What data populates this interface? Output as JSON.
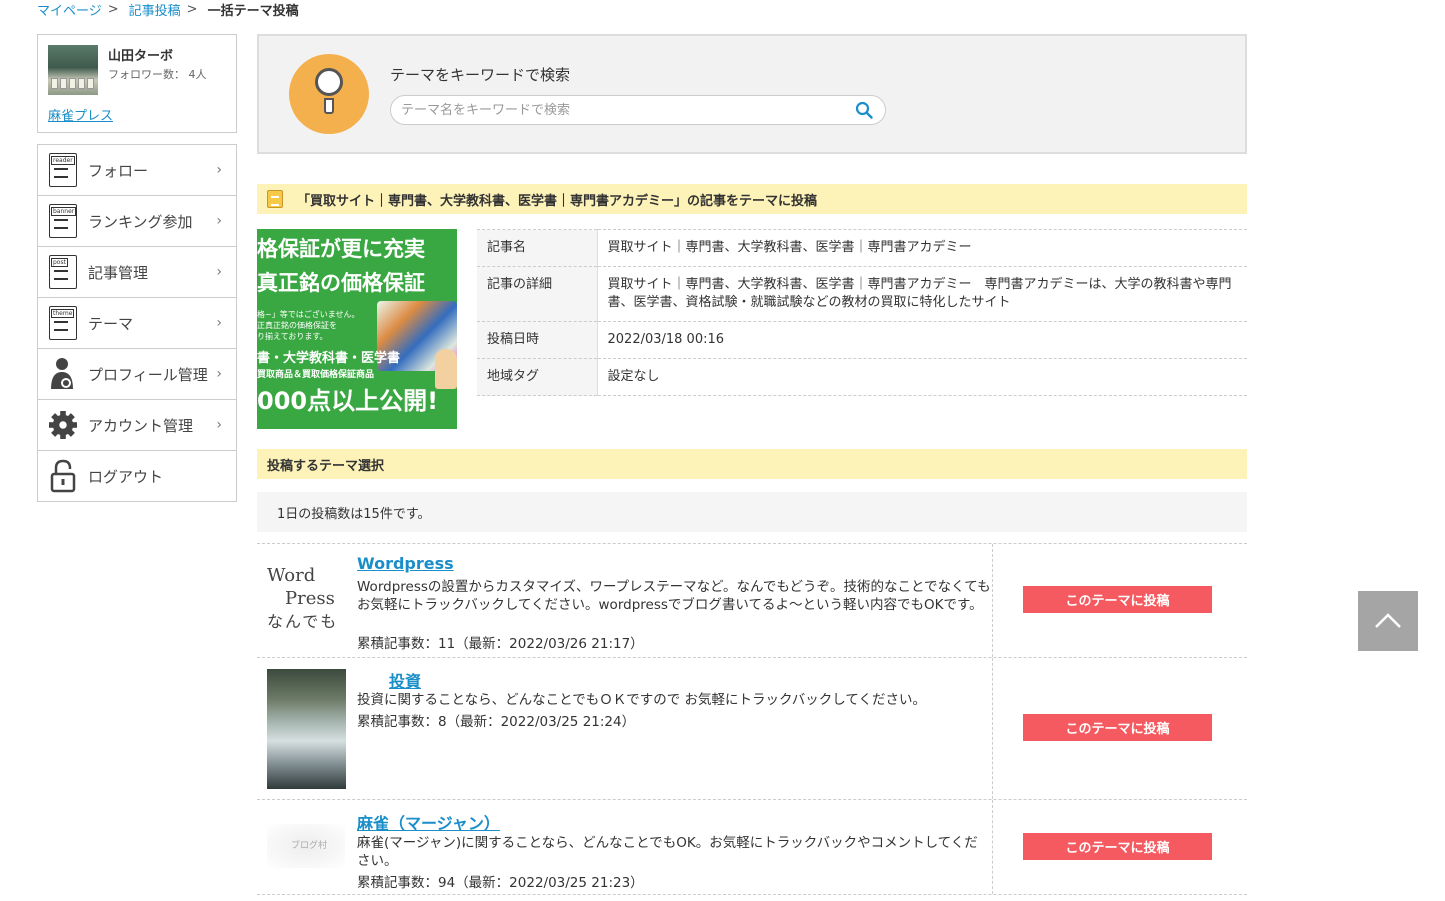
{
  "breadcrumb": {
    "items": [
      "マイページ",
      "記事投稿"
    ],
    "separator": ">",
    "current": "一括テーマ投稿"
  },
  "profile": {
    "name": "山田ターボ",
    "followers": "フォロワー数： 4人",
    "blog_name": "麻雀プレス"
  },
  "sidebar": {
    "items": [
      {
        "label": "フォロー",
        "icon": "reader-icon",
        "icon_tag": "reader"
      },
      {
        "label": "ランキング参加",
        "icon": "banner-icon",
        "icon_tag": "banner"
      },
      {
        "label": "記事管理",
        "icon": "post-icon",
        "icon_tag": "post"
      },
      {
        "label": "テーマ",
        "icon": "theme-icon",
        "icon_tag": "theme"
      },
      {
        "label": "プロフィール管理",
        "icon": "profile-icon"
      },
      {
        "label": "アカウント管理",
        "icon": "gear-icon"
      },
      {
        "label": "ログアウト",
        "icon": "lock-icon"
      }
    ],
    "chevron": "›"
  },
  "search": {
    "title": "テーマをキーワードで検索",
    "placeholder": "テーマ名をキーワードで検索",
    "value": ""
  },
  "post_section": {
    "heading": "「買取サイト｜専門書、大学教科書、医学書｜専門書アカデミー」の記事をテーマに投稿",
    "image": {
      "lines": [
        "格保証が更に充実",
        "真正銘の価格保証",
        "格~」等ではございません。\n正真正銘の価格保証を\nり揃えております。",
        "書・大学教科書・医学書",
        "買取商品＆買取価格保証商品",
        "000点以上公開!"
      ]
    },
    "details": [
      {
        "key": "記事名",
        "value": "買取サイト｜専門書、大学教科書、医学書｜専門書アカデミー"
      },
      {
        "key": "記事の詳細",
        "value": "買取サイト｜専門書、大学教科書、医学書｜専門書アカデミー　専門書アカデミーは、大学の教科書や専門書、医学書、資格試験・就職試験などの教材の買取に特化したサイト"
      },
      {
        "key": "投稿日時",
        "value": "2022/03/18 00:16"
      },
      {
        "key": "地域タグ",
        "value": "設定なし"
      }
    ]
  },
  "theme_section": {
    "heading": "投稿するテーマ選択",
    "daily_limit": "1日の投稿数は15件です。",
    "button_label": "このテーマに投稿",
    "themes": [
      {
        "title": "Wordpress",
        "description": "Wordpressの設置からカスタマイズ、ワープレステーマなど。なんでもどうぞ。技術的なことでなくてもお気軽にトラックバックしてください。wordpressでブログ書いてるよ～という軽い内容でもOKです。",
        "count": "累積記事数：11（最新：2022/03/26 21:17）",
        "thumb_lines": [
          "Word",
          "Press",
          "なんでも"
        ]
      },
      {
        "title": "投資",
        "description": "投資に関することなら、どんなことでもＯＫですので お気軽にトラックバックしてください。",
        "count": "累積記事数：8（最新：2022/03/25 21:24）"
      },
      {
        "title": "麻雀（マージャン）",
        "description": "麻雀(マージャン)に関することなら、どんなことでもOK。お気軽にトラックバックやコメントしてください。",
        "count": "累積記事数：94（最新：2022/03/25 21:23）",
        "thumb_text": "ブログ村"
      }
    ]
  },
  "colors": {
    "link": "#1a8ec9",
    "accent_button": "#f45a5f",
    "heading_bg": "#fdf2b8",
    "search_icon_bg": "#f5b04e"
  }
}
